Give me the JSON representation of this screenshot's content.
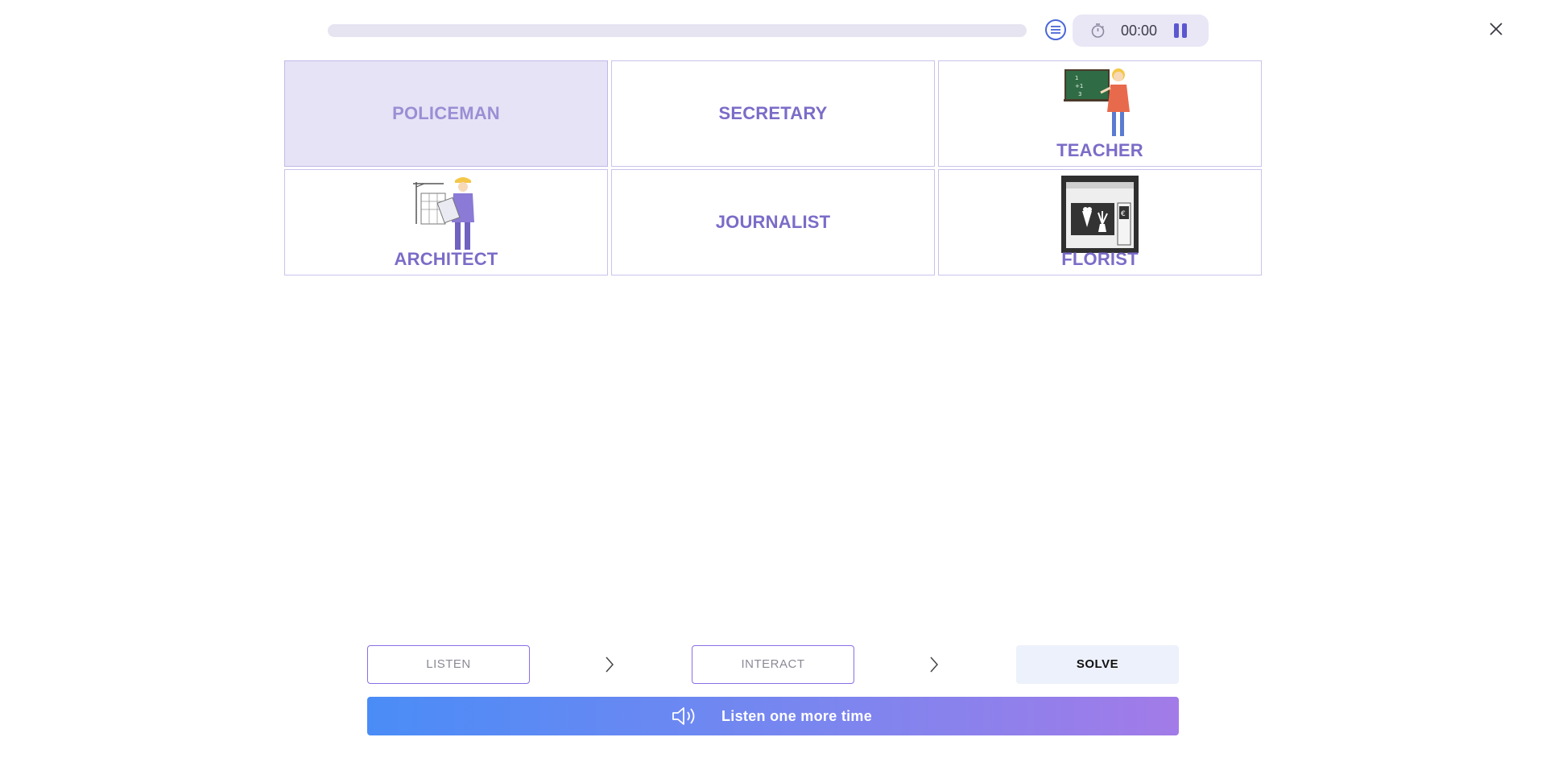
{
  "header": {
    "progress_fraction": 0,
    "timer": "00:00",
    "icons": [
      "list-icon",
      "stopwatch-icon",
      "pause-icon",
      "close-icon"
    ]
  },
  "cards": [
    {
      "label": "POLICEMAN",
      "selected": true,
      "image": null
    },
    {
      "label": "SECRETARY",
      "selected": false,
      "image": null
    },
    {
      "label": "TEACHER",
      "selected": false,
      "image": "teacher-at-chalkboard"
    },
    {
      "label": "ARCHITECT",
      "selected": false,
      "image": "architect-with-crane"
    },
    {
      "label": "JOURNALIST",
      "selected": false,
      "image": null
    },
    {
      "label": "FLORIST",
      "selected": false,
      "image": "flower-shop"
    }
  ],
  "steps": {
    "listen": "LISTEN",
    "interact": "INTERACT",
    "solve": "SOLVE"
  },
  "listen_again": {
    "label": "Listen one more time",
    "icon": "speaker-icon"
  },
  "colors": {
    "accent": "#7b6cc8",
    "selected_card_bg": "#e6e3f6",
    "gradient_start": "#4a8cf7",
    "gradient_end": "#a27be8"
  }
}
